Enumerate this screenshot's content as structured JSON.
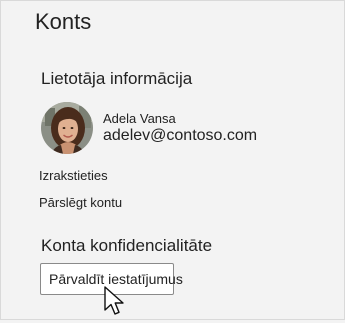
{
  "header": {
    "title": "Konts"
  },
  "user_info": {
    "section_title": "Lietotāja informācija",
    "name": "Adela Vansa",
    "email": "adelev@contoso.com"
  },
  "actions": {
    "sign_out": "Izrakstieties",
    "switch_account": "Pārslēgt kontu"
  },
  "privacy": {
    "section_title": "Konta konfidencialitāte",
    "manage_button": "Pārvaldīt iestatījumus"
  },
  "colors": {
    "background": "#f3f3f3",
    "text": "#222222",
    "button_border": "#8a8a8a"
  }
}
